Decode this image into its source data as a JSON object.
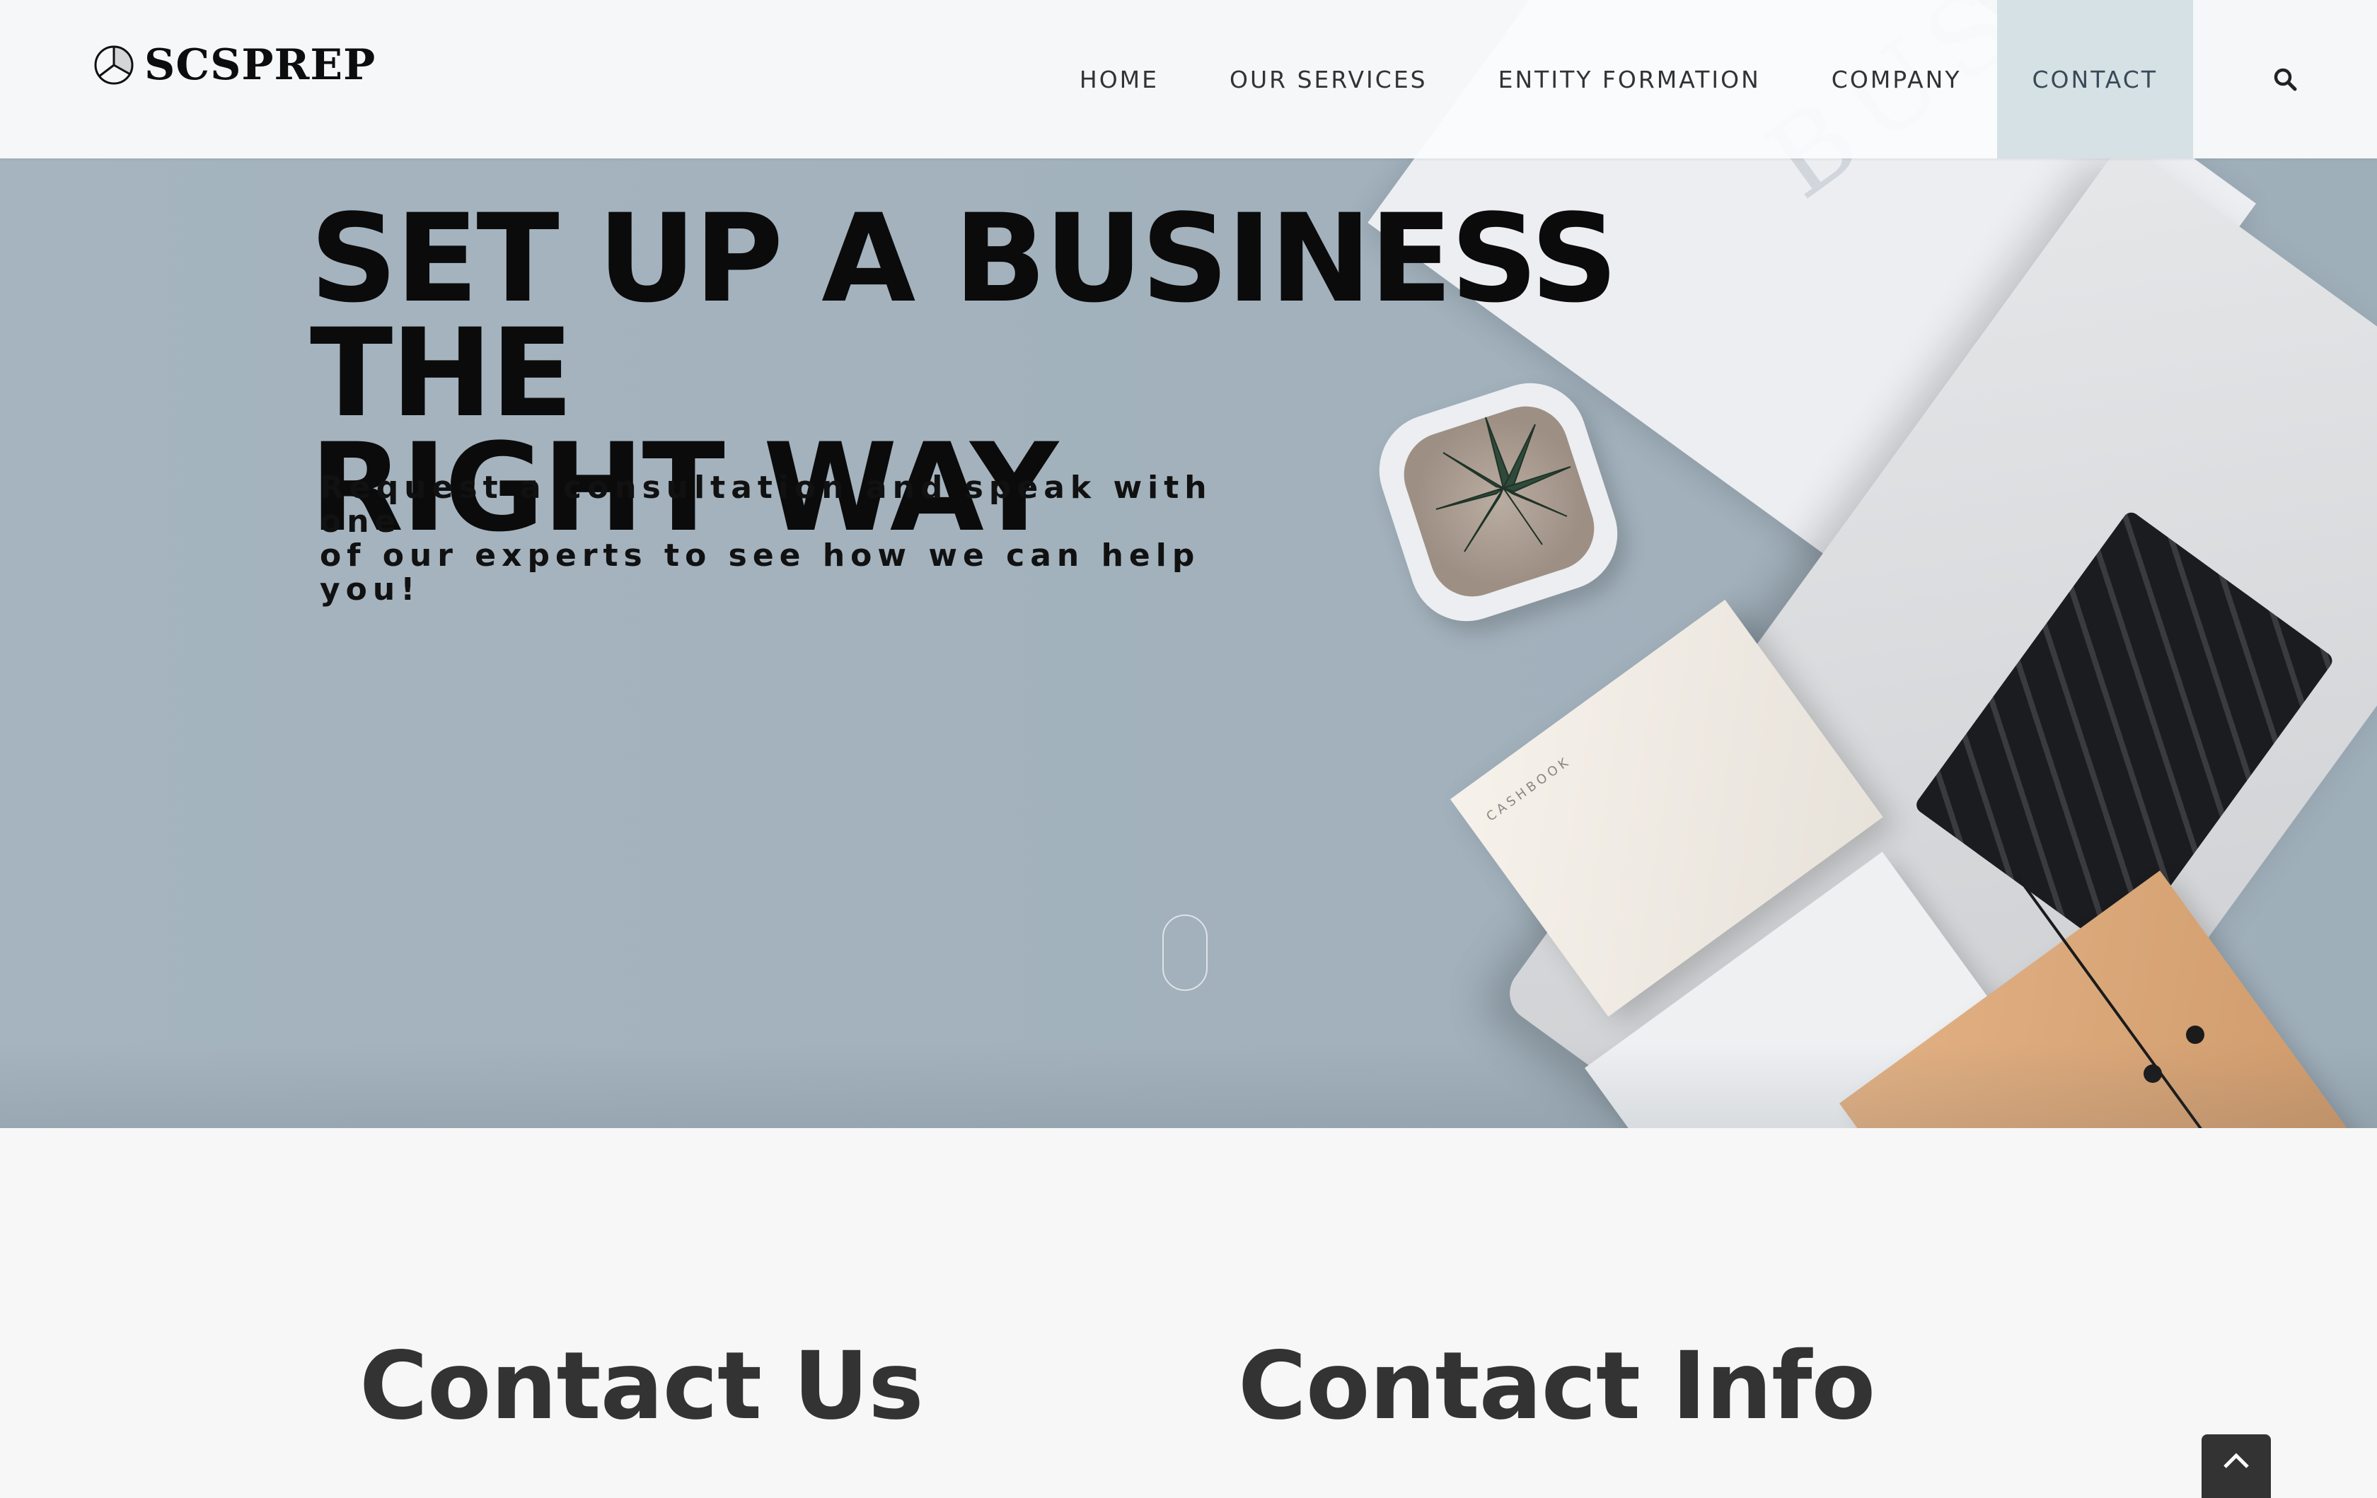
{
  "header": {
    "brand": "SCSPREP",
    "logo_icon": "pie-chart-icon",
    "nav": [
      {
        "label": "HOME",
        "active": false
      },
      {
        "label": "OUR SERVICES",
        "active": false
      },
      {
        "label": "ENTITY FORMATION",
        "active": false
      },
      {
        "label": "COMPANY",
        "active": false
      },
      {
        "label": "CONTACT",
        "active": true
      }
    ],
    "search_icon": "search-icon",
    "active_color": "#d6e1e6"
  },
  "hero": {
    "title_line1": "SET UP A BUSINESS THE",
    "title_line2": "RIGHT WAY",
    "subtitle_line1": "Request a consultation and speak with one",
    "subtitle_line2": "of our experts to see how we can help you!",
    "background_color": "#a5b4bf",
    "scroll_icon": "mouse-scroll-icon"
  },
  "sections": {
    "contact_us_title": "Contact Us",
    "contact_info_title": "Contact Info"
  },
  "back_to_top_icon": "chevron-up-icon"
}
